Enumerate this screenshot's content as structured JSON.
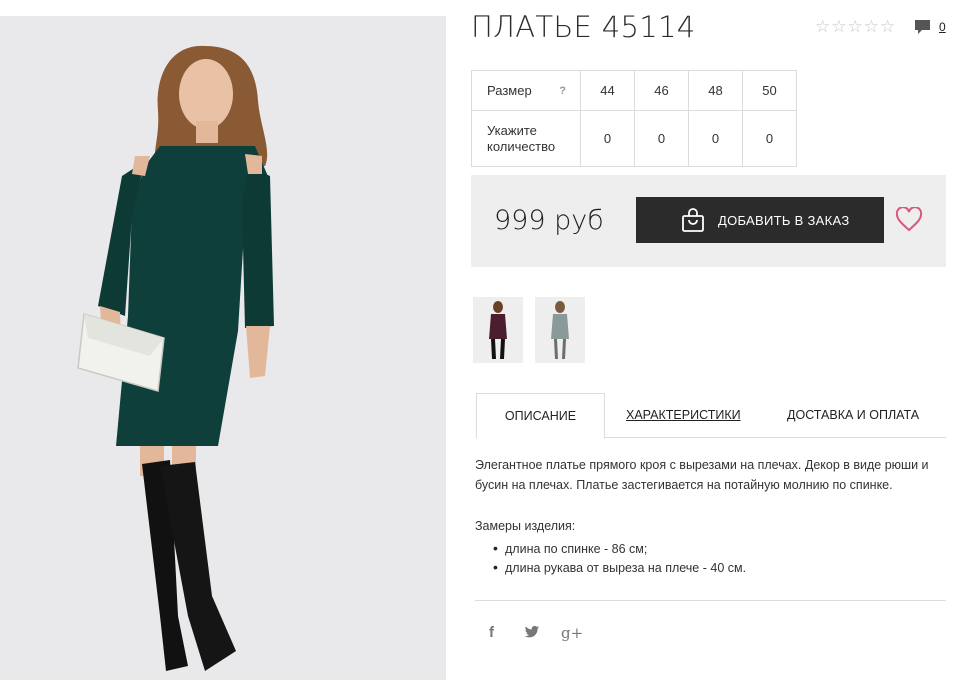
{
  "product": {
    "title": "ПЛАТЬЕ 45114",
    "rating": {
      "value": 0,
      "max": 5,
      "icon": "star-outline-icon"
    },
    "comments_count": "0",
    "price": "999 руб",
    "add_button_label": "ДОБАВИТЬ В ЗАКАЗ",
    "main_image_alt": "dark green dress with cut-out shoulders, white clutch and black over-the-knee boots"
  },
  "size_table": {
    "size_label": "Размер",
    "help_mark": "?",
    "quantity_label": "Укажите количество",
    "sizes": [
      "44",
      "46",
      "48",
      "50"
    ],
    "quantities": [
      "0",
      "0",
      "0",
      "0"
    ]
  },
  "thumbnails": [
    {
      "color": "#4a1e2e",
      "icon": "thumbnail-burgundy"
    },
    {
      "color": "#8a9a9a",
      "icon": "thumbnail-grey"
    }
  ],
  "tabs": [
    "ОПИСАНИЕ",
    "ХАРАКТЕРИСТИКИ",
    "ДОСТАВКА И ОПЛАТА"
  ],
  "description": {
    "text": "Элегантное платье прямого кроя с вырезами на плечах. Декор в виде рюши и бусин на плечах. Платье застегивается на потайную молнию по спинке.",
    "measures_title": "Замеры изделия:",
    "measures": [
      "длина по спинке - 86 см;",
      "длина рукава от выреза на плече - 40 см."
    ]
  },
  "social": {
    "facebook": "f",
    "twitter": "twitter-icon",
    "google_plus": "g+"
  },
  "colors": {
    "dress": "#0f3f3a",
    "button": "#2b2b2b",
    "heart": "#d9587a",
    "panel": "#eeeeee"
  }
}
